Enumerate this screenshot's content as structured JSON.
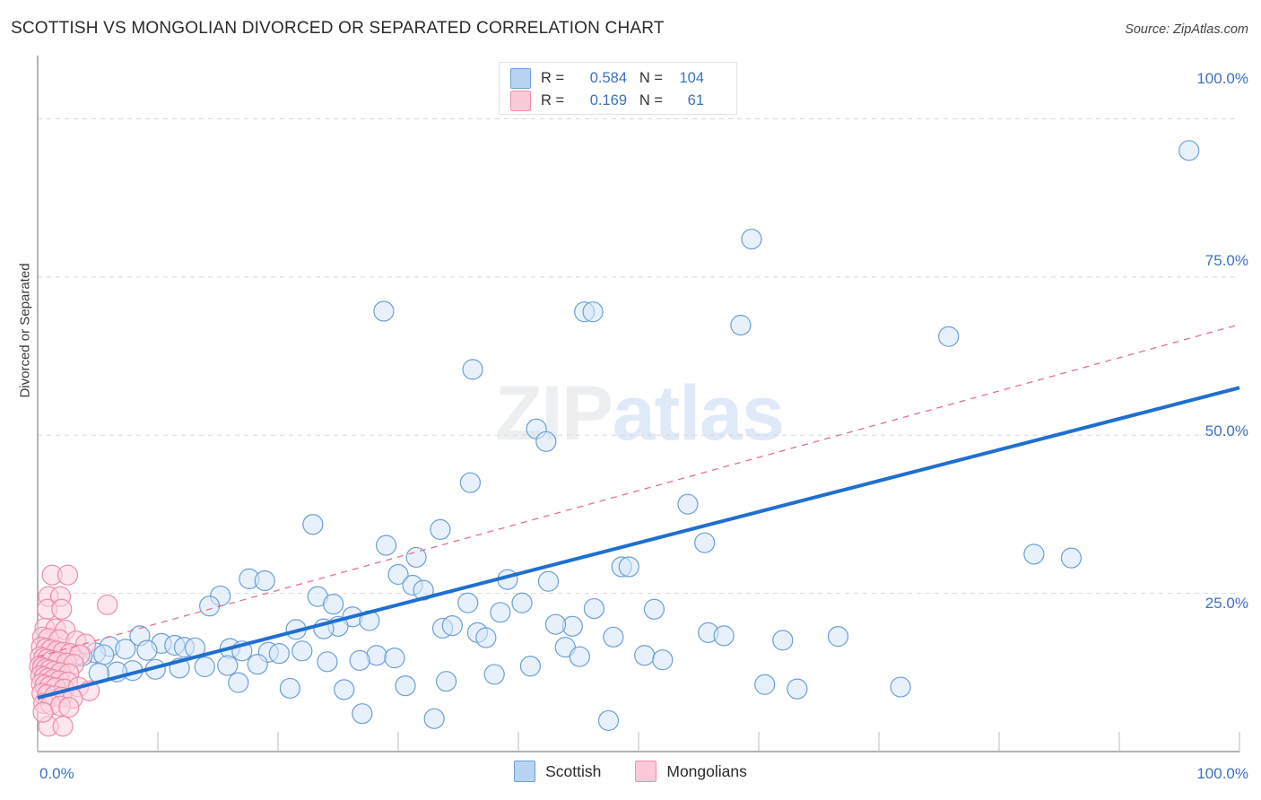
{
  "header": {
    "title": "SCOTTISH VS MONGOLIAN DIVORCED OR SEPARATED CORRELATION CHART",
    "source": "Source: ZipAtlas.com"
  },
  "watermark": {
    "part1": "ZIP",
    "part2": "atlas"
  },
  "stats": {
    "rows": [
      {
        "series": "Scottish",
        "r_label": "R =",
        "r_value": "0.584",
        "n_label": "N =",
        "n_value": "104",
        "color": "#b9d3f2"
      },
      {
        "series": "Mongolians",
        "r_label": "R =",
        "r_value": "0.169",
        "n_label": "N =",
        "n_value": "61",
        "color": "#fbc9d8"
      }
    ]
  },
  "legend": {
    "items": [
      {
        "label": "Scottish",
        "color": "#b9d3f2",
        "border": "#6b9fd8"
      },
      {
        "label": "Mongolians",
        "color": "#fbc9d8",
        "border": "#ef8fae"
      }
    ]
  },
  "axes": {
    "ylabel": "Divorced or Separated",
    "yticks": [
      "100.0%",
      "75.0%",
      "50.0%",
      "25.0%"
    ],
    "ytick_y": [
      88,
      292,
      484,
      674
    ],
    "xticks": [
      "0.0%",
      "100.0%"
    ],
    "xlim": [
      0,
      100
    ],
    "ylim": [
      0,
      110
    ]
  },
  "colors": {
    "scottish_fill": "#d6e6f8",
    "scottish_stroke": "#6b9fd8",
    "mongolian_fill": "#fbd4de",
    "mongolian_stroke": "#f08ba8",
    "scottish_line": "#1f6fd0",
    "mongolian_line": "#e2718f",
    "grid": "#d8d8d8",
    "axis": "#9a9a9a",
    "tick_text": "#3b72c4"
  },
  "chart_data": {
    "type": "scatter",
    "title": "SCOTTISH VS MONGOLIAN DIVORCED OR SEPARATED CORRELATION CHART",
    "xlabel": "",
    "ylabel": "Divorced or Separated",
    "xlim": [
      0,
      100
    ],
    "ylim": [
      0,
      110
    ],
    "grid": true,
    "legend_position": "bottom-center",
    "series": [
      {
        "name": "Scottish",
        "r": 0.584,
        "n": 104,
        "color": "#d6e6f8",
        "trendline": {
          "x0": 0,
          "y0": 8.5,
          "x1": 100,
          "y1": 57.5,
          "style": "solid",
          "color": "#1f6fd0"
        },
        "points": [
          [
            95.8,
            95.0
          ],
          [
            59.4,
            81.0
          ],
          [
            45.5,
            69.5
          ],
          [
            46.2,
            69.5
          ],
          [
            28.8,
            69.6
          ],
          [
            58.5,
            67.4
          ],
          [
            75.8,
            65.6
          ],
          [
            36.2,
            60.4
          ],
          [
            41.5,
            51.0
          ],
          [
            42.3,
            49.0
          ],
          [
            36.0,
            42.5
          ],
          [
            54.1,
            39.1
          ],
          [
            22.9,
            35.9
          ],
          [
            33.5,
            35.1
          ],
          [
            55.5,
            33.0
          ],
          [
            29.0,
            32.6
          ],
          [
            82.9,
            31.2
          ],
          [
            31.5,
            30.7
          ],
          [
            48.6,
            29.2
          ],
          [
            49.2,
            29.2
          ],
          [
            30.0,
            28.0
          ],
          [
            17.6,
            27.3
          ],
          [
            18.9,
            27.0
          ],
          [
            39.1,
            27.2
          ],
          [
            42.5,
            26.9
          ],
          [
            31.2,
            26.3
          ],
          [
            32.1,
            25.5
          ],
          [
            15.2,
            24.6
          ],
          [
            23.3,
            24.5
          ],
          [
            14.3,
            23.0
          ],
          [
            24.6,
            23.3
          ],
          [
            35.8,
            23.5
          ],
          [
            40.3,
            23.5
          ],
          [
            46.3,
            22.6
          ],
          [
            38.5,
            22.0
          ],
          [
            51.3,
            22.5
          ],
          [
            26.2,
            21.3
          ],
          [
            27.6,
            20.7
          ],
          [
            25.0,
            19.8
          ],
          [
            21.5,
            19.3
          ],
          [
            23.8,
            19.4
          ],
          [
            33.7,
            19.5
          ],
          [
            34.5,
            19.9
          ],
          [
            36.6,
            18.8
          ],
          [
            37.3,
            18.0
          ],
          [
            44.5,
            19.8
          ],
          [
            43.1,
            20.1
          ],
          [
            47.9,
            18.1
          ],
          [
            55.8,
            18.8
          ],
          [
            57.1,
            18.3
          ],
          [
            66.6,
            18.2
          ],
          [
            62.0,
            17.6
          ],
          [
            8.5,
            18.3
          ],
          [
            10.3,
            17.1
          ],
          [
            11.4,
            16.8
          ],
          [
            12.2,
            16.5
          ],
          [
            13.1,
            16.4
          ],
          [
            6.0,
            16.6
          ],
          [
            7.3,
            16.2
          ],
          [
            9.1,
            16.0
          ],
          [
            16.0,
            16.3
          ],
          [
            17.0,
            15.9
          ],
          [
            19.2,
            15.7
          ],
          [
            20.1,
            15.5
          ],
          [
            22.0,
            15.9
          ],
          [
            4.8,
            15.6
          ],
          [
            5.5,
            15.3
          ],
          [
            3.7,
            15.1
          ],
          [
            3.0,
            14.9
          ],
          [
            2.3,
            14.7
          ],
          [
            1.7,
            14.5
          ],
          [
            1.2,
            14.3
          ],
          [
            0.8,
            14.1
          ],
          [
            0.5,
            13.9
          ],
          [
            28.2,
            15.2
          ],
          [
            29.7,
            14.8
          ],
          [
            26.8,
            14.4
          ],
          [
            24.1,
            14.2
          ],
          [
            18.3,
            13.8
          ],
          [
            15.8,
            13.6
          ],
          [
            13.9,
            13.4
          ],
          [
            11.8,
            13.2
          ],
          [
            9.8,
            13.0
          ],
          [
            7.9,
            12.8
          ],
          [
            6.6,
            12.6
          ],
          [
            5.1,
            12.4
          ],
          [
            43.9,
            16.5
          ],
          [
            45.1,
            15.0
          ],
          [
            50.5,
            15.2
          ],
          [
            52.0,
            14.5
          ],
          [
            41.0,
            13.5
          ],
          [
            38.0,
            12.2
          ],
          [
            34.0,
            11.1
          ],
          [
            30.6,
            10.4
          ],
          [
            16.7,
            10.9
          ],
          [
            21.0,
            10.0
          ],
          [
            25.5,
            9.8
          ],
          [
            60.5,
            10.6
          ],
          [
            63.2,
            9.9
          ],
          [
            71.8,
            10.2
          ],
          [
            27.0,
            6.0
          ],
          [
            33.0,
            5.2
          ],
          [
            47.5,
            4.9
          ],
          [
            86.0,
            30.6
          ]
        ]
      },
      {
        "name": "Mongolians",
        "r": 0.169,
        "n": 61,
        "color": "#fbd4de",
        "trendline": {
          "x0": 0,
          "y0": 15.0,
          "x1": 100,
          "y1": 67.5,
          "style": "dashed",
          "color": "#e2718f"
        },
        "points": [
          [
            1.2,
            27.9
          ],
          [
            2.5,
            27.9
          ],
          [
            0.9,
            24.5
          ],
          [
            1.9,
            24.5
          ],
          [
            0.8,
            22.5
          ],
          [
            2.0,
            22.5
          ],
          [
            5.8,
            23.2
          ],
          [
            0.6,
            19.5
          ],
          [
            1.5,
            19.4
          ],
          [
            2.3,
            19.2
          ],
          [
            0.4,
            18.1
          ],
          [
            0.9,
            17.9
          ],
          [
            1.8,
            17.7
          ],
          [
            3.2,
            17.5
          ],
          [
            4.0,
            17.0
          ],
          [
            0.3,
            16.5
          ],
          [
            0.7,
            16.3
          ],
          [
            1.1,
            16.1
          ],
          [
            1.6,
            15.9
          ],
          [
            2.1,
            15.7
          ],
          [
            2.7,
            15.5
          ],
          [
            3.5,
            15.3
          ],
          [
            0.2,
            15.0
          ],
          [
            0.5,
            14.8
          ],
          [
            0.8,
            14.6
          ],
          [
            1.2,
            14.4
          ],
          [
            1.7,
            14.2
          ],
          [
            2.4,
            14.0
          ],
          [
            3.0,
            13.8
          ],
          [
            0.15,
            13.5
          ],
          [
            0.4,
            13.3
          ],
          [
            0.7,
            13.1
          ],
          [
            1.0,
            12.9
          ],
          [
            1.4,
            12.7
          ],
          [
            1.9,
            12.5
          ],
          [
            2.6,
            12.3
          ],
          [
            0.25,
            12.0
          ],
          [
            0.55,
            11.8
          ],
          [
            0.9,
            11.6
          ],
          [
            1.3,
            11.4
          ],
          [
            1.8,
            11.2
          ],
          [
            2.5,
            11.0
          ],
          [
            0.3,
            10.7
          ],
          [
            0.6,
            10.5
          ],
          [
            1.0,
            10.3
          ],
          [
            1.5,
            10.1
          ],
          [
            2.2,
            9.9
          ],
          [
            3.4,
            10.2
          ],
          [
            4.3,
            9.6
          ],
          [
            0.35,
            9.2
          ],
          [
            0.8,
            9.0
          ],
          [
            1.4,
            8.8
          ],
          [
            2.0,
            8.6
          ],
          [
            2.9,
            8.4
          ],
          [
            0.5,
            7.6
          ],
          [
            1.1,
            7.4
          ],
          [
            1.9,
            7.2
          ],
          [
            2.6,
            7.0
          ],
          [
            0.9,
            4.0
          ],
          [
            2.1,
            4.0
          ],
          [
            0.45,
            6.2
          ]
        ]
      }
    ]
  }
}
